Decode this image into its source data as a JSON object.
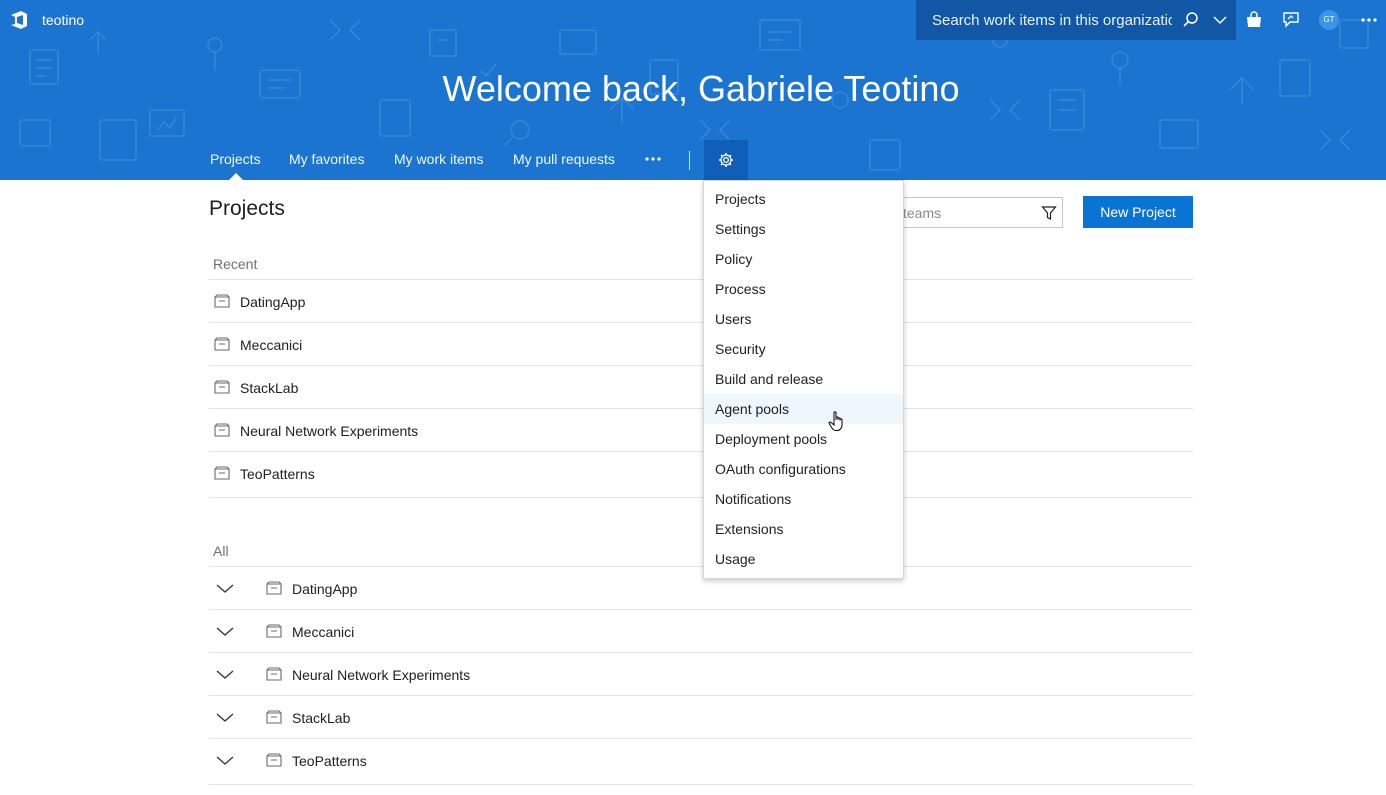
{
  "header": {
    "org_name": "teotino",
    "search_placeholder": "Search work items in this organization",
    "avatar_initials": "GT",
    "welcome": "Welcome back, Gabriele Teotino",
    "accent_color": "#1a74d0"
  },
  "hub_tabs": [
    {
      "label": "Projects",
      "selected": true
    },
    {
      "label": "My favorites"
    },
    {
      "label": "My work items"
    },
    {
      "label": "My pull requests"
    }
  ],
  "main": {
    "title": "Projects",
    "filter_placeholder": "teams",
    "new_project_label": "New Project",
    "recent_label": "Recent",
    "recent": [
      "DatingApp",
      "Meccanici",
      "StackLab",
      "Neural Network Experiments",
      "TeoPatterns"
    ],
    "all_label": "All",
    "all": [
      "DatingApp",
      "Meccanici",
      "Neural Network Experiments",
      "StackLab",
      "TeoPatterns"
    ]
  },
  "settings_menu": {
    "items": [
      "Projects",
      "Settings",
      "Policy",
      "Process",
      "Users",
      "Security",
      "Build and release",
      "Agent pools",
      "Deployment pools",
      "OAuth configurations",
      "Notifications",
      "Extensions",
      "Usage"
    ],
    "hovered": "Agent pools"
  }
}
